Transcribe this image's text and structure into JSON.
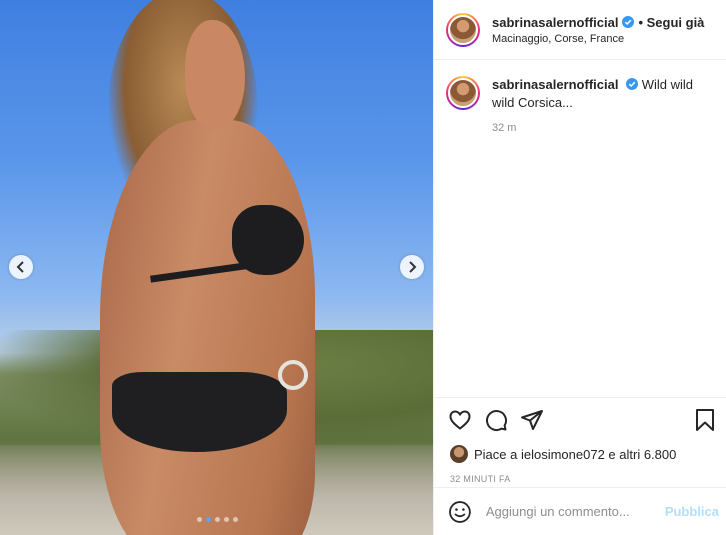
{
  "post": {
    "username": "sabrinasalernofficial",
    "follow_label": "• Segui già",
    "location": "Macinaggio, Corse, France",
    "more_icon": "more-options-icon",
    "verified_color": "#3897f0"
  },
  "caption": {
    "username": "sabrinasalernofficial",
    "text": "Wild wild wild Corsica...",
    "time": "32 m"
  },
  "media": {
    "prev_icon": "chevron-left-icon",
    "next_icon": "chevron-right-icon",
    "slide_count": 5,
    "active_slide": 2
  },
  "actions": {
    "icons": [
      "heart-icon",
      "comment-icon",
      "share-icon",
      "bookmark-icon"
    ]
  },
  "likes": {
    "text": "Piace a ielosimone072 e altri 6.800"
  },
  "timestamp": "32 MINUTI FA",
  "comment": {
    "placeholder": "Aggiungi un commento...",
    "publish_label": "Pubblica",
    "publish_color": "#b2dffc"
  }
}
